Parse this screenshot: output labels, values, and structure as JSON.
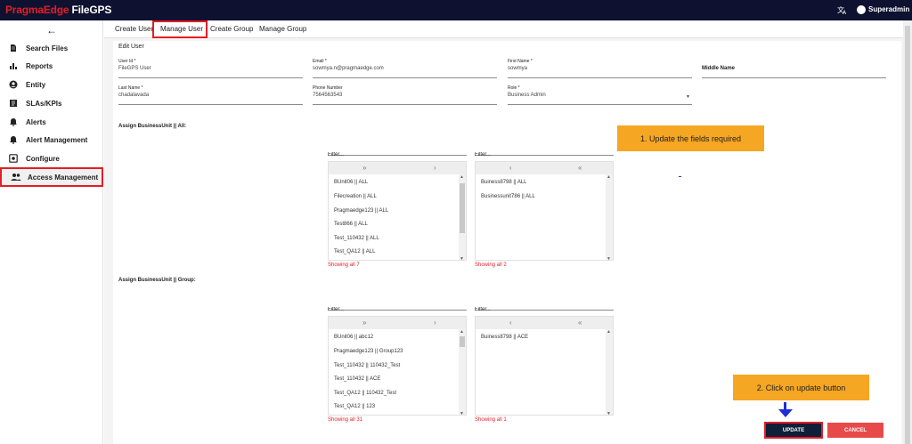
{
  "header": {
    "logo_brand": "PragmaEdge",
    "logo_product": "FileGPS",
    "user_name": "Superadmin"
  },
  "sidebar": {
    "items": [
      {
        "label": "Search Files",
        "icon": "file-icon"
      },
      {
        "label": "Reports",
        "icon": "bar-chart-icon"
      },
      {
        "label": "Entity",
        "icon": "account-circle-icon"
      },
      {
        "label": "SLAs/KPIs",
        "icon": "card-icon"
      },
      {
        "label": "Alerts",
        "icon": "bell-icon"
      },
      {
        "label": "Alert Management",
        "icon": "bell-settings-icon"
      },
      {
        "label": "Configure",
        "icon": "settings-box-icon"
      },
      {
        "label": "Access Management",
        "icon": "people-icon",
        "active": true
      }
    ]
  },
  "tabs": [
    {
      "label": "Create User"
    },
    {
      "label": "Manage User",
      "active": true
    },
    {
      "label": "Create Group"
    },
    {
      "label": "Manage Group"
    }
  ],
  "form": {
    "title": "Edit User",
    "user_id": {
      "label": "User Id *",
      "value": "FileGPS User"
    },
    "email": {
      "label": "Email *",
      "value": "sowmya.n@pragmaedge.com"
    },
    "first_name": {
      "label": "First Name *",
      "value": "sowmya"
    },
    "middle_name": {
      "label": "Middle Name"
    },
    "last_name": {
      "label": "Last Name *",
      "value": "chadalavada"
    },
    "phone": {
      "label": "Phone Number",
      "value": "7564563543"
    },
    "role": {
      "label": "Role *",
      "value": "Business Admin"
    }
  },
  "assign_all": {
    "label": "Assign BusinessUnit || All:",
    "left_filter_placeholder": "Filter...",
    "right_filter_placeholder": "Filter...",
    "left_items": [
      "BUnit06 || ALL",
      "Filecreation || ALL",
      "Pragmaedge123 || ALL",
      "Test866 || ALL",
      "Test_110432 || ALL",
      "Test_QA12 || ALL"
    ],
    "right_items": [
      "Buiness8798 || ALL",
      "Businessunit786 || ALL"
    ],
    "left_showing": "Showing all 7",
    "right_showing": "Showing all 2"
  },
  "assign_group": {
    "label": "Assign BusinessUnit || Group:",
    "left_filter_placeholder": "Filter...",
    "right_filter_placeholder": "Filter...",
    "left_items": [
      "BUnit06 || abc12",
      "Pragmaedge123 || Group123",
      "Test_110432 || 110432_Test",
      "Test_110432 || ACE",
      "Test_QA12 || 110432_Test",
      "Test_QA12 || 123"
    ],
    "right_items": [
      "Buiness8798 || ACE"
    ],
    "left_showing": "Showing all 31",
    "right_showing": "Showing all 1"
  },
  "controls": {
    "move_all_right": "»",
    "move_right": "›",
    "move_left": "‹",
    "move_all_left": "«"
  },
  "callouts": {
    "step1": "1. Update the fields required",
    "step2": "2. Click on update button"
  },
  "buttons": {
    "update": "UPDATE",
    "cancel": "CANCEL"
  },
  "colors": {
    "topbar": "#0e1130",
    "brand_red": "#e31e25",
    "callout": "#f5a623",
    "update_button": "#0f1f3a",
    "cancel_button": "#e84a4a"
  }
}
